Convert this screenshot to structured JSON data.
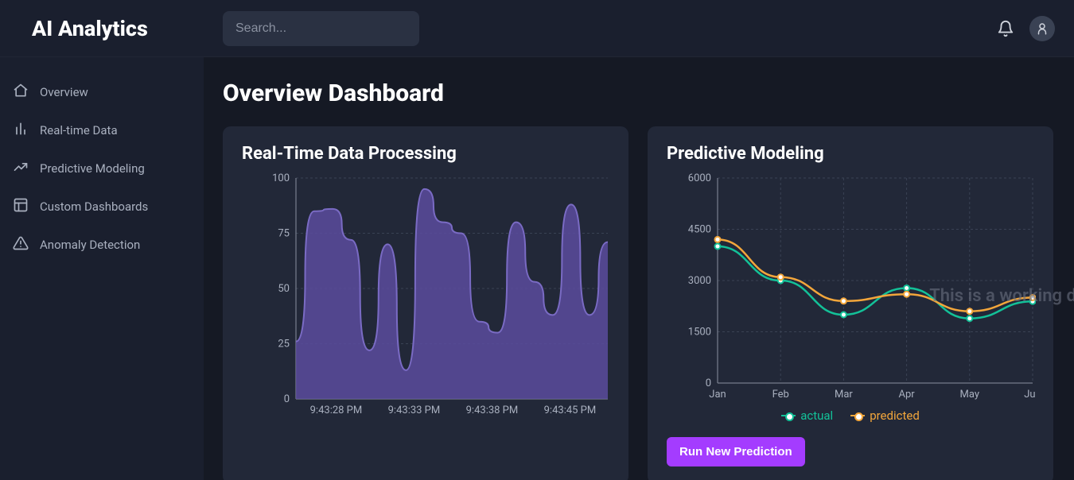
{
  "app_name": "AI Analytics",
  "search": {
    "placeholder": "Search..."
  },
  "sidebar": {
    "items": [
      {
        "label": "Overview",
        "icon": "home-icon"
      },
      {
        "label": "Real-time Data",
        "icon": "chart-bar-icon"
      },
      {
        "label": "Predictive Modeling",
        "icon": "trend-up-icon"
      },
      {
        "label": "Custom Dashboards",
        "icon": "layout-icon"
      },
      {
        "label": "Anomaly Detection",
        "icon": "alert-triangle-icon"
      }
    ]
  },
  "page": {
    "title": "Overview Dashboard"
  },
  "realtime_card": {
    "title": "Real-Time Data Processing"
  },
  "predictive_card": {
    "title": "Predictive Modeling",
    "button": "Run New Prediction",
    "legend_actual": "actual",
    "legend_predicted": "predicted",
    "watermark": "This is a working demo w"
  },
  "colors": {
    "area_fill": "#5b4b9e",
    "area_stroke": "#7a6bc4",
    "actual": "#13c198",
    "predicted": "#f3a63b",
    "accent": "#a43cff"
  },
  "chart_data": [
    {
      "id": "realtime",
      "type": "area",
      "title": "Real-Time Data Processing",
      "xlabel": "",
      "ylabel": "",
      "ylim": [
        0,
        100
      ],
      "yticks": [
        0,
        25,
        50,
        75,
        100
      ],
      "x_labels": [
        "9:43:28 PM",
        "9:43:33 PM",
        "9:43:38 PM",
        "9:43:45 PM"
      ],
      "values": [
        26,
        85,
        86,
        72,
        22,
        70,
        13,
        95,
        80,
        75,
        35,
        30,
        80,
        53,
        38,
        88,
        38,
        71
      ]
    },
    {
      "id": "predictive",
      "type": "line",
      "title": "Predictive Modeling",
      "xlabel": "",
      "ylabel": "",
      "ylim": [
        0,
        6000
      ],
      "yticks": [
        0,
        1500,
        3000,
        4500,
        6000
      ],
      "categories": [
        "Jan",
        "Feb",
        "Mar",
        "Apr",
        "May",
        "Jun"
      ],
      "series": [
        {
          "name": "actual",
          "values": [
            4000,
            3000,
            2000,
            2780,
            1890,
            2390
          ]
        },
        {
          "name": "predicted",
          "values": [
            4200,
            3100,
            2400,
            2600,
            2100,
            2500
          ]
        }
      ]
    }
  ]
}
